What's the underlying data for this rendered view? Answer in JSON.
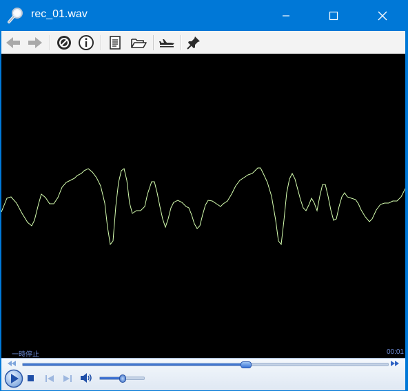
{
  "window": {
    "title": "rec_01.wav"
  },
  "titlebar_buttons": {
    "minimize": "minimize-icon",
    "maximize": "maximize-icon",
    "close": "close-icon"
  },
  "toolbar": {
    "items": [
      "back-arrow-icon",
      "forward-arrow-icon",
      "stop-sign-icon",
      "info-icon",
      "document-icon",
      "open-folder-icon",
      "airplane-icon",
      "pin-icon"
    ]
  },
  "status": {
    "state": "一時停止",
    "time": "00:01"
  },
  "playback": {
    "seek_fraction": 0.61,
    "volume_fraction": 0.5
  },
  "colors": {
    "window_accent": "#0078d7",
    "waveform": "#d6ffb0",
    "visualizer_bg": "#000000",
    "status_text": "#6d8cd6"
  },
  "waveform": {
    "points": [
      [
        0,
        308
      ],
      [
        8,
        288
      ],
      [
        14,
        286
      ],
      [
        22,
        295
      ],
      [
        30,
        310
      ],
      [
        38,
        323
      ],
      [
        44,
        328
      ],
      [
        48,
        320
      ],
      [
        54,
        296
      ],
      [
        58,
        282
      ],
      [
        64,
        287
      ],
      [
        70,
        296
      ],
      [
        76,
        296
      ],
      [
        82,
        287
      ],
      [
        88,
        272
      ],
      [
        94,
        265
      ],
      [
        100,
        262
      ],
      [
        106,
        259
      ],
      [
        110,
        255
      ],
      [
        116,
        252
      ],
      [
        120,
        248
      ],
      [
        126,
        245
      ],
      [
        132,
        250
      ],
      [
        138,
        258
      ],
      [
        144,
        270
      ],
      [
        150,
        295
      ],
      [
        154,
        330
      ],
      [
        158,
        355
      ],
      [
        162,
        350
      ],
      [
        166,
        300
      ],
      [
        170,
        265
      ],
      [
        174,
        248
      ],
      [
        178,
        245
      ],
      [
        182,
        262
      ],
      [
        186,
        295
      ],
      [
        190,
        310
      ],
      [
        196,
        306
      ],
      [
        202,
        306
      ],
      [
        208,
        300
      ],
      [
        212,
        282
      ],
      [
        218,
        264
      ],
      [
        222,
        264
      ],
      [
        226,
        280
      ],
      [
        230,
        300
      ],
      [
        234,
        318
      ],
      [
        238,
        330
      ],
      [
        242,
        318
      ],
      [
        246,
        302
      ],
      [
        250,
        294
      ],
      [
        256,
        291
      ],
      [
        262,
        294
      ],
      [
        268,
        300
      ],
      [
        272,
        302
      ],
      [
        276,
        312
      ],
      [
        280,
        325
      ],
      [
        284,
        332
      ],
      [
        288,
        328
      ],
      [
        292,
        312
      ],
      [
        296,
        298
      ],
      [
        300,
        291
      ],
      [
        306,
        292
      ],
      [
        312,
        296
      ],
      [
        318,
        300
      ],
      [
        322,
        296
      ],
      [
        328,
        292
      ],
      [
        334,
        282
      ],
      [
        340,
        270
      ],
      [
        346,
        262
      ],
      [
        352,
        258
      ],
      [
        358,
        254
      ],
      [
        364,
        252
      ],
      [
        368,
        248
      ],
      [
        372,
        244
      ],
      [
        376,
        244
      ],
      [
        380,
        252
      ],
      [
        386,
        265
      ],
      [
        392,
        285
      ],
      [
        398,
        320
      ],
      [
        402,
        350
      ],
      [
        406,
        355
      ],
      [
        410,
        320
      ],
      [
        414,
        280
      ],
      [
        418,
        260
      ],
      [
        422,
        252
      ],
      [
        426,
        260
      ],
      [
        430,
        275
      ],
      [
        434,
        290
      ],
      [
        438,
        302
      ],
      [
        442,
        306
      ],
      [
        446,
        298
      ],
      [
        450,
        288
      ],
      [
        454,
        295
      ],
      [
        458,
        306
      ],
      [
        462,
        285
      ],
      [
        466,
        268
      ],
      [
        470,
        268
      ],
      [
        474,
        285
      ],
      [
        478,
        305
      ],
      [
        482,
        320
      ],
      [
        486,
        318
      ],
      [
        490,
        300
      ],
      [
        494,
        286
      ],
      [
        498,
        280
      ],
      [
        502,
        286
      ],
      [
        508,
        288
      ],
      [
        514,
        290
      ],
      [
        518,
        296
      ],
      [
        522,
        305
      ],
      [
        528,
        315
      ],
      [
        534,
        322
      ],
      [
        538,
        318
      ],
      [
        544,
        305
      ],
      [
        550,
        297
      ],
      [
        556,
        295
      ],
      [
        562,
        295
      ],
      [
        568,
        292
      ],
      [
        574,
        292
      ],
      [
        580,
        286
      ],
      [
        586,
        274
      ],
      [
        590,
        270
      ]
    ]
  }
}
